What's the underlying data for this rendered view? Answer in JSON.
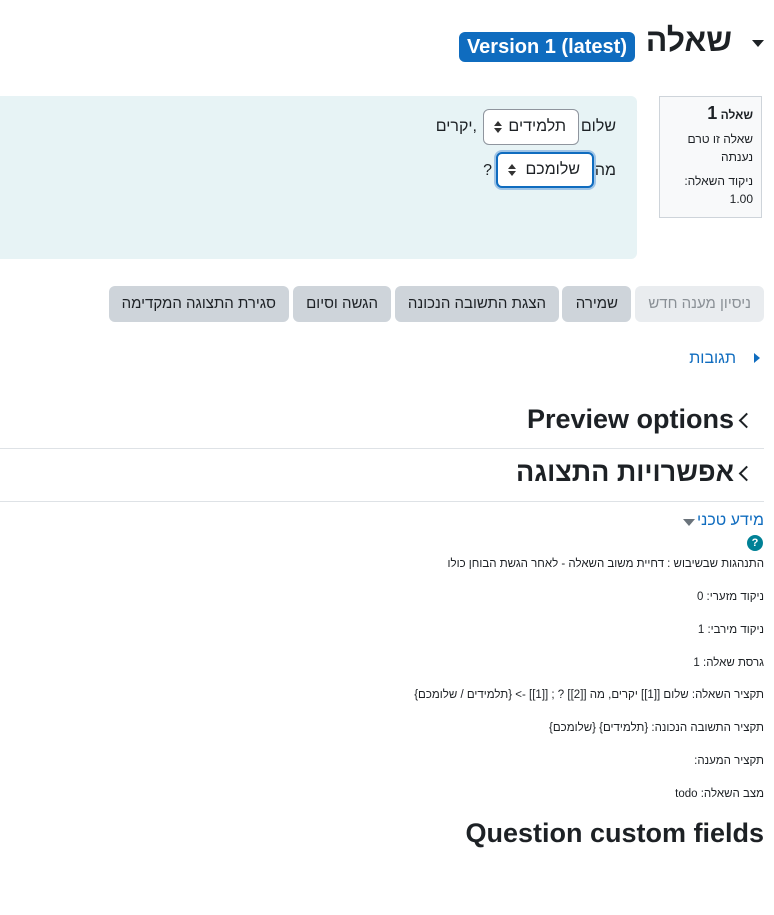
{
  "header": {
    "title": "שאלה",
    "version_badge": "Version 1 (latest)"
  },
  "info": {
    "question_prefix": "שאלה",
    "question_number": "1",
    "status": "שאלה זו טרם נענתה",
    "marks": "ניקוד השאלה: 1.00"
  },
  "question": {
    "word_hello": "שלום",
    "select1_value": "תלמידים",
    "word_dear": "יקרים,",
    "word_what": "מה",
    "select2_value": "שלומכם",
    "question_mark": "?"
  },
  "buttons": {
    "new_attempt": "ניסיון מענה חדש",
    "save": "שמירה",
    "show_correct": "הצגת התשובה הנכונה",
    "submit_finish": "הגשה וסיום",
    "close_preview": "סגירת התצוגה המקדימה"
  },
  "responses_link": "תגובות",
  "sections": {
    "preview_options": "Preview options",
    "display_options": "אפשרויות התצוגה"
  },
  "technical": {
    "link": "מידע טכני",
    "help_icon_glyph": "?",
    "lines": [
      "התנהגות שבשיבוש : דחיית משוב השאלה - לאחר הגשת הבוחן כולו",
      "ניקוד מזערי: 0",
      "ניקוד מירבי: 1",
      "גרסת שאלה: 1",
      "תקציר השאלה: שלום [[1]] יקרים, מה [[2]] ? ; [[1]] -> {תלמידים / שלומכם}",
      "תקציר התשובה הנכונה: {תלמידים} {שלומכם}",
      "תקציר המענה:",
      "מצב השאלה: todo"
    ]
  },
  "custom_fields_heading": "Question custom fields",
  "colors": {
    "primary": "#0f6cbf",
    "question_bg": "#e7f3f5",
    "button_bg": "#ced4da",
    "help_icon": "#008196"
  },
  "icons": [
    "chevron-down-icon",
    "select-arrows-icon",
    "caret-right-icon",
    "chevron-left-icon",
    "help-icon"
  ]
}
